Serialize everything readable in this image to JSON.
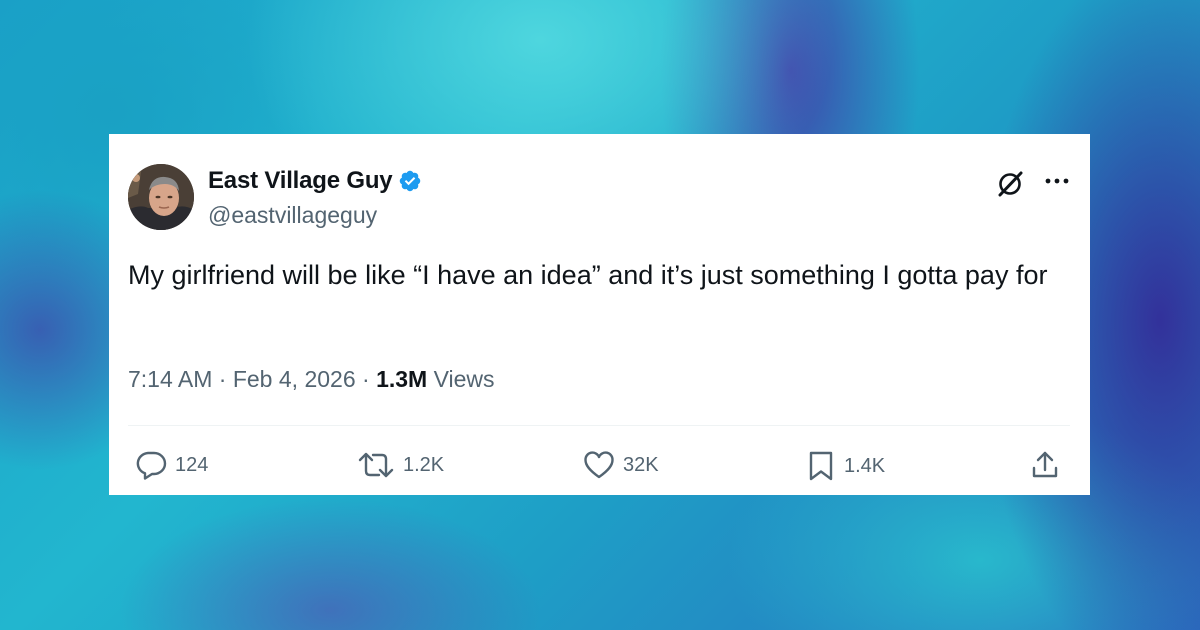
{
  "theme": {
    "text_primary": "#0f1419",
    "text_secondary": "#536471",
    "verified_blue": "#1d9bf0",
    "card_background": "#ffffff"
  },
  "user": {
    "display_name": "East Village Guy",
    "handle": "@eastvillageguy",
    "verified": true,
    "avatar_icon": "profile-photo"
  },
  "header_icons": {
    "grok": "grok-icon",
    "more": "more-icon"
  },
  "tweet": {
    "text": "My girlfriend will be like “I have an idea” and it’s just something I gotta pay for",
    "time": "7:14 AM",
    "separator": "·",
    "date": "Feb 4, 2026",
    "views_count": "1.3M",
    "views_label": "Views"
  },
  "actions": {
    "replies": {
      "icon": "reply-icon",
      "count": "124"
    },
    "reposts": {
      "icon": "repost-icon",
      "count": "1.2K"
    },
    "likes": {
      "icon": "heart-icon",
      "count": "32K"
    },
    "bookmarks": {
      "icon": "bookmark-icon",
      "count": "1.4K"
    },
    "share": {
      "icon": "share-icon"
    }
  }
}
